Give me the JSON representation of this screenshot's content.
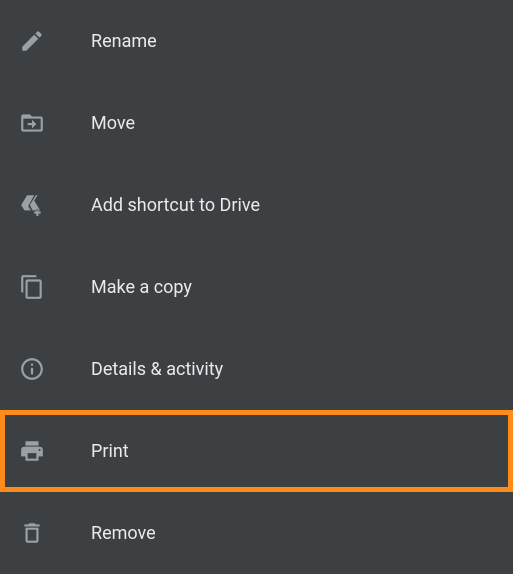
{
  "menu": {
    "items": [
      {
        "label": "Rename",
        "highlighted": false
      },
      {
        "label": "Move",
        "highlighted": false
      },
      {
        "label": "Add shortcut to Drive",
        "highlighted": false
      },
      {
        "label": "Make a copy",
        "highlighted": false
      },
      {
        "label": "Details & activity",
        "highlighted": false
      },
      {
        "label": "Print",
        "highlighted": true
      },
      {
        "label": "Remove",
        "highlighted": false
      }
    ]
  }
}
